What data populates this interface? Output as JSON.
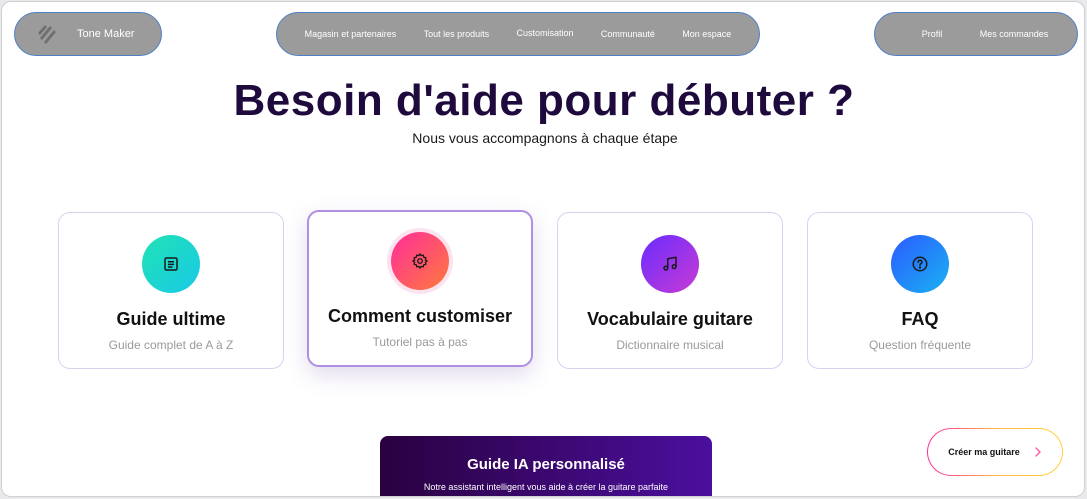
{
  "nav": {
    "brand": "Tone Maker",
    "main_links": [
      "Magasin et partenaires",
      "Tout les produits",
      "Customisation",
      "Communauté",
      "Mon espace"
    ],
    "user_links": [
      "Profil",
      "Mes commandes"
    ]
  },
  "hero": {
    "title": "Besoin d'aide pour débuter ?",
    "subtitle": "Nous vous accompagnons à chaque étape"
  },
  "cards": [
    {
      "title": "Guide ultime",
      "subtitle": "Guide complet de A à Z",
      "icon": "document-icon"
    },
    {
      "title": "Comment customiser",
      "subtitle": "Tutoriel pas à pas",
      "icon": "gear-icon"
    },
    {
      "title": "Vocabulaire guitare",
      "subtitle": "Dictionnaire musical",
      "icon": "music-note-icon"
    },
    {
      "title": "FAQ",
      "subtitle": "Question fréquente",
      "icon": "question-icon"
    }
  ],
  "ai_panel": {
    "title": "Guide IA personnalisé",
    "subtitle": "Notre assistant intelligent vous aide à créer la guitare parfaite"
  },
  "cta": {
    "label": "Créer ma guitare"
  },
  "colors": {
    "nav_bg": "#9b9b9b",
    "nav_border": "#4e7fc7",
    "title": "#1e0a3c",
    "card_border": "#dcd0f0",
    "ai_gradient_start": "#2a0140",
    "ai_gradient_end": "#4b0f9e"
  }
}
